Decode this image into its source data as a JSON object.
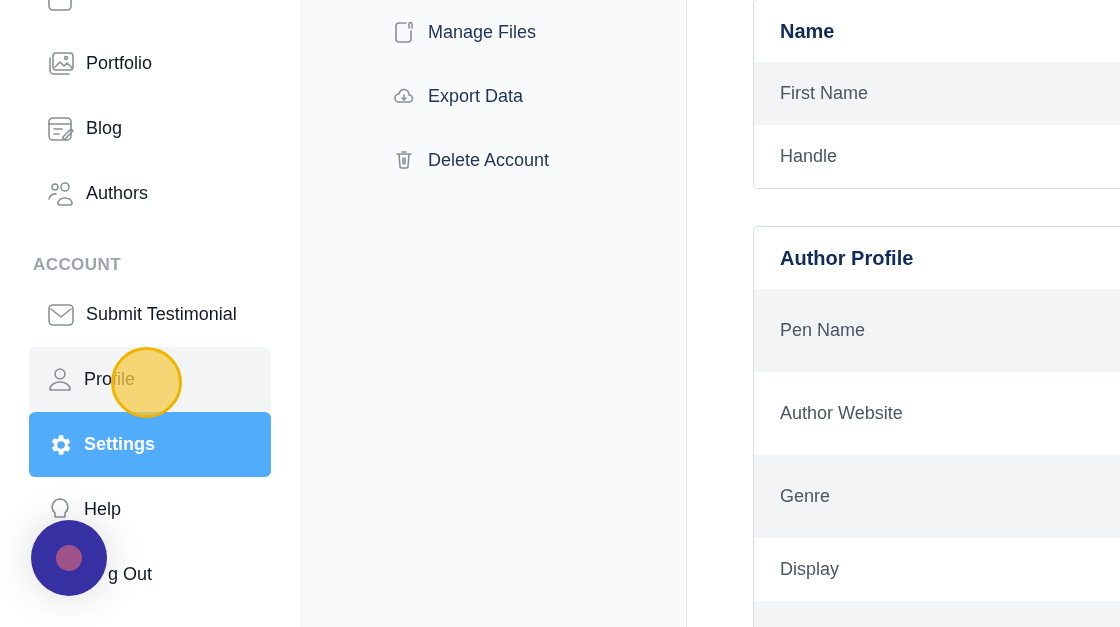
{
  "sidebar": {
    "items": [
      {
        "kind": "link",
        "label": "Portfolio",
        "selected": false,
        "hovered": false
      },
      {
        "kind": "link",
        "label": "Blog",
        "selected": false,
        "hovered": false
      },
      {
        "kind": "link",
        "label": "Authors",
        "selected": false,
        "hovered": false
      },
      {
        "kind": "heading",
        "label": "ACCOUNT"
      },
      {
        "kind": "link",
        "label": "Submit Testimonial",
        "selected": false,
        "hovered": false
      },
      {
        "kind": "link",
        "label": "Profile",
        "selected": false,
        "hovered": true
      },
      {
        "kind": "link",
        "label": "Settings",
        "selected": true,
        "hovered": false
      },
      {
        "kind": "link",
        "label": "Help",
        "selected": false,
        "hovered": false
      },
      {
        "kind": "covered_link",
        "label": "g Out",
        "selected": false,
        "hovered": false
      }
    ]
  },
  "settings_menu": {
    "items": [
      {
        "label": "Manage Files"
      },
      {
        "label": "Export Data"
      },
      {
        "label": "Delete Account"
      }
    ]
  },
  "cards": [
    {
      "title": "Name",
      "rows": [
        "First Name",
        "Handle"
      ]
    },
    {
      "title": "Author Profile",
      "rows": [
        "Pen Name",
        "Author Website",
        "Genre",
        "Display"
      ]
    }
  ]
}
